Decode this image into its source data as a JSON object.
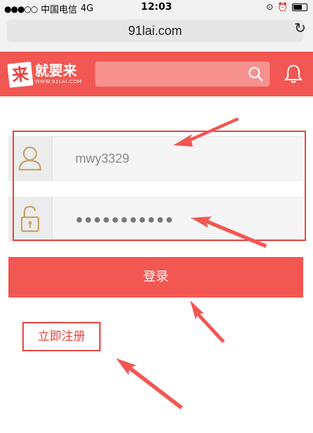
{
  "status_bar": {
    "carrier": "中国电信",
    "network": "4G",
    "time": "12:03"
  },
  "browser": {
    "url": "91lai.com"
  },
  "header": {
    "logo_mark": "来",
    "logo_name": "就要来",
    "logo_domain": "WWW.91LAI.COM",
    "search_placeholder": ""
  },
  "form": {
    "username_value": "mwy3329",
    "password_value": "●●●●●●●●●●●",
    "login_label": "登录",
    "register_label": "立即注册"
  },
  "colors": {
    "brand_red": "#f25752",
    "annotation_red": "#e8443f"
  }
}
